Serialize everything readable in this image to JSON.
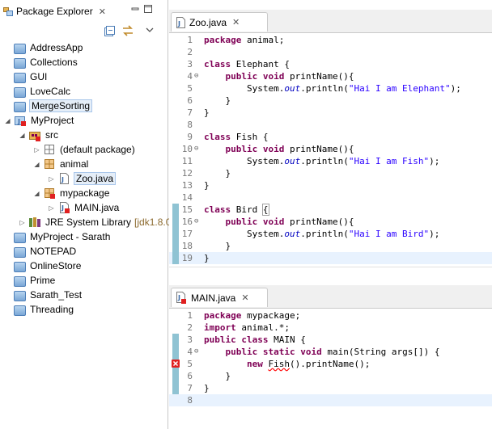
{
  "package_explorer": {
    "title": "Package Explorer",
    "close": "✕",
    "items": [
      {
        "label": "AddressApp",
        "icon": "folder-icon",
        "indent": 0
      },
      {
        "label": "Collections",
        "icon": "folder-icon",
        "indent": 0
      },
      {
        "label": "GUI",
        "icon": "folder-icon",
        "indent": 0
      },
      {
        "label": "LoveCalc",
        "icon": "folder-icon",
        "indent": 0
      },
      {
        "label": "MergeSorting",
        "icon": "folder-icon",
        "indent": 0,
        "selected": true
      },
      {
        "label": "MyProject",
        "icon": "java-project-icon",
        "indent": 0,
        "toggle": "expanded"
      },
      {
        "label": "src",
        "icon": "source-folder-icon",
        "indent": 1,
        "toggle": "expanded"
      },
      {
        "label": "(default package)",
        "icon": "empty-package-icon",
        "indent": 2,
        "toggle": "collapsed"
      },
      {
        "label": "animal",
        "icon": "package-icon",
        "indent": 2,
        "toggle": "expanded"
      },
      {
        "label": "Zoo.java",
        "icon": "java-file-icon",
        "indent": 3,
        "toggle": "collapsed",
        "selected": true
      },
      {
        "label": "mypackage",
        "icon": "package-error-icon",
        "indent": 2,
        "toggle": "expanded"
      },
      {
        "label": "MAIN.java",
        "icon": "java-file-error-icon",
        "indent": 3,
        "toggle": "collapsed"
      },
      {
        "label": "JRE System Library",
        "suffix": "[jdk1.8.0_",
        "icon": "library-icon",
        "indent": 1,
        "toggle": "collapsed"
      },
      {
        "label": "MyProject - Sarath",
        "icon": "folder-icon",
        "indent": 0
      },
      {
        "label": "NOTEPAD",
        "icon": "folder-icon",
        "indent": 0
      },
      {
        "label": "OnlineStore",
        "icon": "folder-icon",
        "indent": 0
      },
      {
        "label": "Prime",
        "icon": "folder-icon",
        "indent": 0
      },
      {
        "label": "Sarath_Test",
        "icon": "folder-icon",
        "indent": 0
      },
      {
        "label": "Threading",
        "icon": "folder-icon",
        "indent": 0
      }
    ]
  },
  "editor_zoo": {
    "tab": "Zoo.java",
    "close": "✕",
    "lines": [
      {
        "n": "1",
        "code": "package animal;"
      },
      {
        "n": "2",
        "code": ""
      },
      {
        "n": "3",
        "code": "class Elephant {"
      },
      {
        "n": "4",
        "code": "    public void printName(){",
        "fold": "⊖"
      },
      {
        "n": "5",
        "code": "        System.out.println(\"Hai I am Elephant\");"
      },
      {
        "n": "6",
        "code": "    }"
      },
      {
        "n": "7",
        "code": "}"
      },
      {
        "n": "8",
        "code": ""
      },
      {
        "n": "9",
        "code": "class Fish {"
      },
      {
        "n": "10",
        "code": "    public void printName(){",
        "fold": "⊖"
      },
      {
        "n": "11",
        "code": "        System.out.println(\"Hai I am Fish\");"
      },
      {
        "n": "12",
        "code": "    }"
      },
      {
        "n": "13",
        "code": "}"
      },
      {
        "n": "14",
        "code": ""
      },
      {
        "n": "15",
        "code": "class Bird {",
        "marker": true
      },
      {
        "n": "16",
        "code": "    public void printName(){",
        "fold": "⊖",
        "marker": true
      },
      {
        "n": "17",
        "code": "        System.out.println(\"Hai I am Bird\");",
        "marker": true
      },
      {
        "n": "18",
        "code": "    }",
        "marker": true
      },
      {
        "n": "19",
        "code": "}",
        "marker": true,
        "current": true
      }
    ]
  },
  "editor_main": {
    "tab": "MAIN.java",
    "close": "✕",
    "lines": [
      {
        "n": "1",
        "code": "package mypackage;"
      },
      {
        "n": "2",
        "code": "import animal.*;"
      },
      {
        "n": "3",
        "code": "public class MAIN {",
        "marker": true
      },
      {
        "n": "4",
        "code": "    public static void main(String args[]) {",
        "fold": "⊖",
        "marker": true
      },
      {
        "n": "5",
        "code": "        new Fish().printName();",
        "marker": true,
        "error": true
      },
      {
        "n": "6",
        "code": "    }",
        "marker": true
      },
      {
        "n": "7",
        "code": "}",
        "marker": true
      },
      {
        "n": "8",
        "code": "",
        "current": true
      }
    ]
  }
}
